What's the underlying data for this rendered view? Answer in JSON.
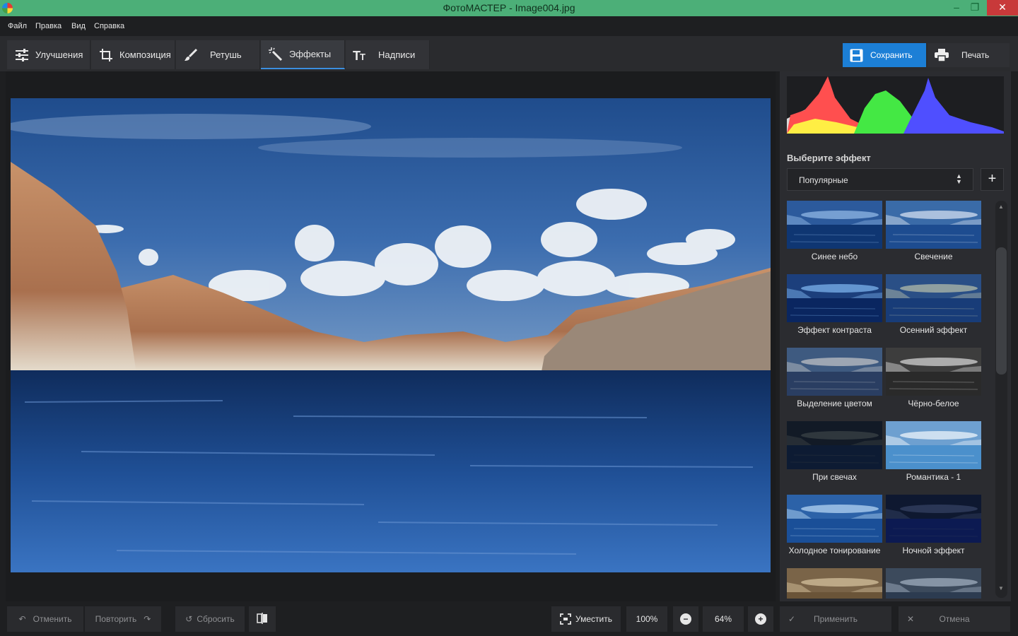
{
  "window": {
    "title": "ФотоМАСТЕР - Image004.jpg",
    "minimize": "‒",
    "maximize": "❐",
    "close": "✕"
  },
  "menu": [
    "Файл",
    "Правка",
    "Вид",
    "Справка"
  ],
  "tabs": [
    {
      "label": "Улучшения",
      "icon": "sliders-icon",
      "active": false
    },
    {
      "label": "Композиция",
      "icon": "crop-icon",
      "active": false
    },
    {
      "label": "Ретушь",
      "icon": "brush-icon",
      "active": false
    },
    {
      "label": "Эффекты",
      "icon": "magic-wand-icon",
      "active": true
    },
    {
      "label": "Надписи",
      "icon": "text-icon",
      "active": false
    }
  ],
  "actions": {
    "save": "Сохранить",
    "print": "Печать"
  },
  "panel": {
    "choose_effect": "Выберите эффект",
    "category": "Популярные",
    "add": "+",
    "effects": [
      {
        "label": "Синее небо",
        "style": "blue-sky"
      },
      {
        "label": "Свечение",
        "style": "glow"
      },
      {
        "label": "Эффект контраста",
        "style": "contrast"
      },
      {
        "label": "Осенний эффект",
        "style": "autumn"
      },
      {
        "label": "Выделение цветом",
        "style": "color-select"
      },
      {
        "label": "Чёрно-белое",
        "style": "bw"
      },
      {
        "label": "При свечах",
        "style": "candle"
      },
      {
        "label": "Романтика - 1",
        "style": "romantic"
      },
      {
        "label": "Холодное тонирование",
        "style": "cold"
      },
      {
        "label": "Ночной эффект",
        "style": "night"
      },
      {
        "label": "",
        "style": "sepia"
      },
      {
        "label": "",
        "style": "grey-blue"
      }
    ]
  },
  "bottom": {
    "undo": "Отменить",
    "redo": "Повторить",
    "reset": "Сбросить",
    "fit": "Уместить",
    "zoom_100": "100%",
    "zoom_value": "64%",
    "apply": "Применить",
    "cancel": "Отмена"
  },
  "colors": {
    "accent": "#1c7fd6",
    "titlebar": "#4caf78",
    "close": "#c8393a"
  }
}
